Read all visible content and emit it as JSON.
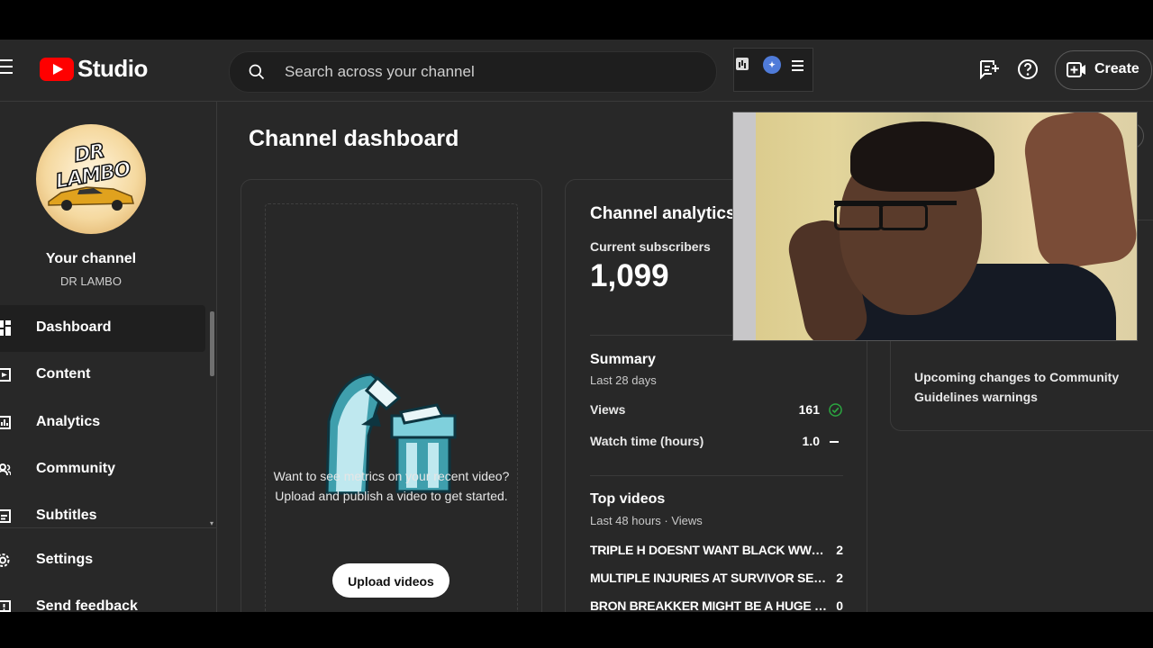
{
  "header": {
    "brand": "Studio",
    "search_placeholder": "Search across your channel",
    "create_label": "Create"
  },
  "sidebar": {
    "avatar_text": "DR LAMBO",
    "channel_label": "Your channel",
    "channel_name": "DR LAMBO",
    "items": [
      {
        "label": "Dashboard",
        "icon": "dashboard-icon",
        "active": true
      },
      {
        "label": "Content",
        "icon": "content-icon"
      },
      {
        "label": "Analytics",
        "icon": "analytics-icon"
      },
      {
        "label": "Community",
        "icon": "community-icon"
      },
      {
        "label": "Subtitles",
        "icon": "subtitles-icon"
      },
      {
        "label": "Settings",
        "icon": "settings-icon"
      },
      {
        "label": "Send feedback",
        "icon": "feedback-icon"
      }
    ]
  },
  "main": {
    "page_title": "Channel dashboard",
    "upload_card": {
      "line1": "Want to see metrics on your recent video?",
      "line2": "Upload and publish a video to get started.",
      "button_label": "Upload videos"
    },
    "analytics": {
      "title": "Channel analytics",
      "subscribers_label": "Current subscribers",
      "subscribers_value": "1,099",
      "summary_title": "Summary",
      "summary_period": "Last 28 days",
      "metrics": [
        {
          "label": "Views",
          "value": "161",
          "status": "check"
        },
        {
          "label": "Watch time (hours)",
          "value": "1.0",
          "status": "dash"
        }
      ],
      "top_videos_title": "Top videos",
      "top_videos_period": "Last 48 hours · Views",
      "top_videos": [
        {
          "title": "TRIPLE H DOESNT WANT BLACK WWE …",
          "views": "2"
        },
        {
          "title": "MULTIPLE INJURIES AT SURVIVOR SERI…",
          "views": "2"
        },
        {
          "title": "BRON BREAKKER MIGHT BE A HUGE FO…",
          "views": "0"
        }
      ]
    },
    "news": {
      "text": "Upcoming changes to Community Guidelines warnings"
    }
  },
  "colors": {
    "background": "#282828",
    "brand_red": "#ff0000",
    "check_green": "#2ba640"
  }
}
